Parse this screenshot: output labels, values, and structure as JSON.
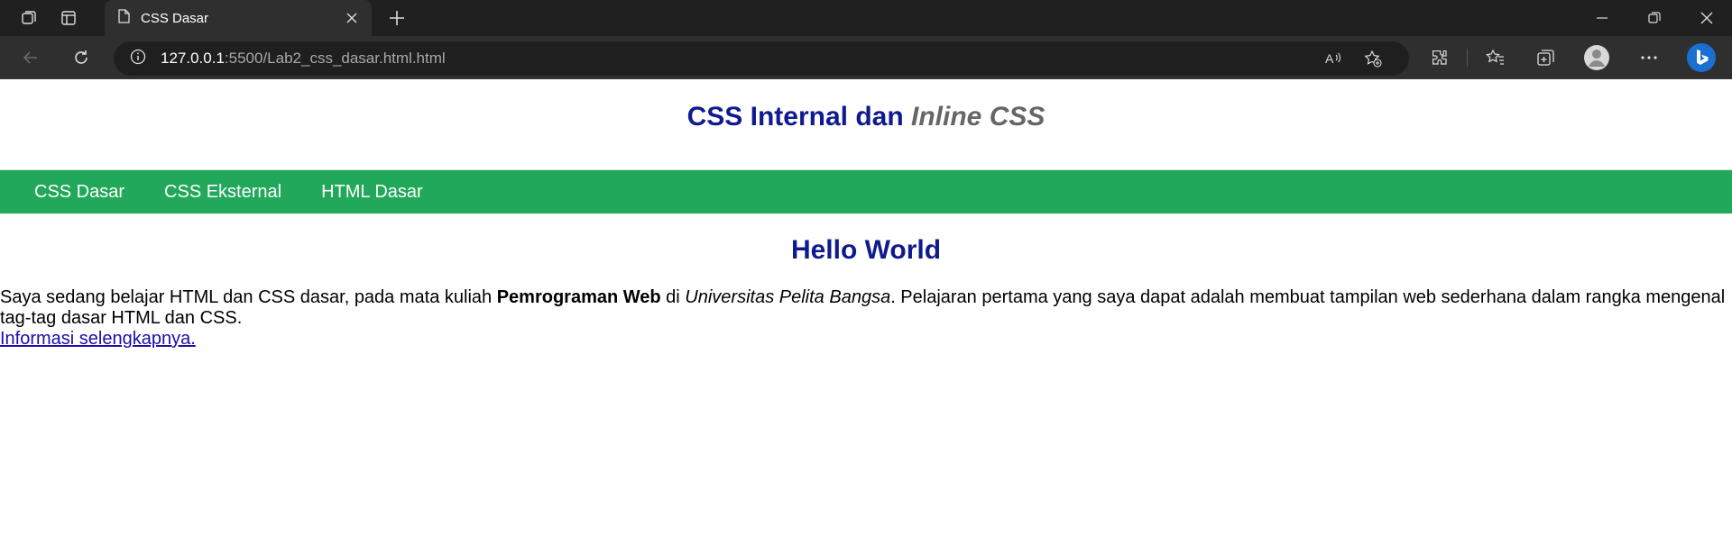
{
  "browser": {
    "tab_title": "CSS Dasar",
    "url_host": "127.0.0.1",
    "url_path": ":5500/Lab2_css_dasar.html.html"
  },
  "page": {
    "title_main": "CSS Internal dan ",
    "title_italic": "Inline CSS",
    "nav": [
      "CSS Dasar",
      "CSS Eksternal",
      "HTML Dasar"
    ],
    "heading": "Hello World",
    "para_1": "Saya sedang belajar HTML dan CSS dasar, pada mata kuliah ",
    "para_bold": "Pemrograman Web",
    "para_2": " di ",
    "para_italic": "Universitas Pelita Bangsa",
    "para_3": ". Pelajaran pertama yang saya dapat adalah membuat tampilan web sederhana dalam rangka mengenal tag-tag dasar HTML dan CSS.",
    "link": "Informasi selengkapnya."
  },
  "colors": {
    "heading": "#0f1a8f",
    "nav_bg": "#22a85a",
    "chrome_bg": "#202020"
  }
}
